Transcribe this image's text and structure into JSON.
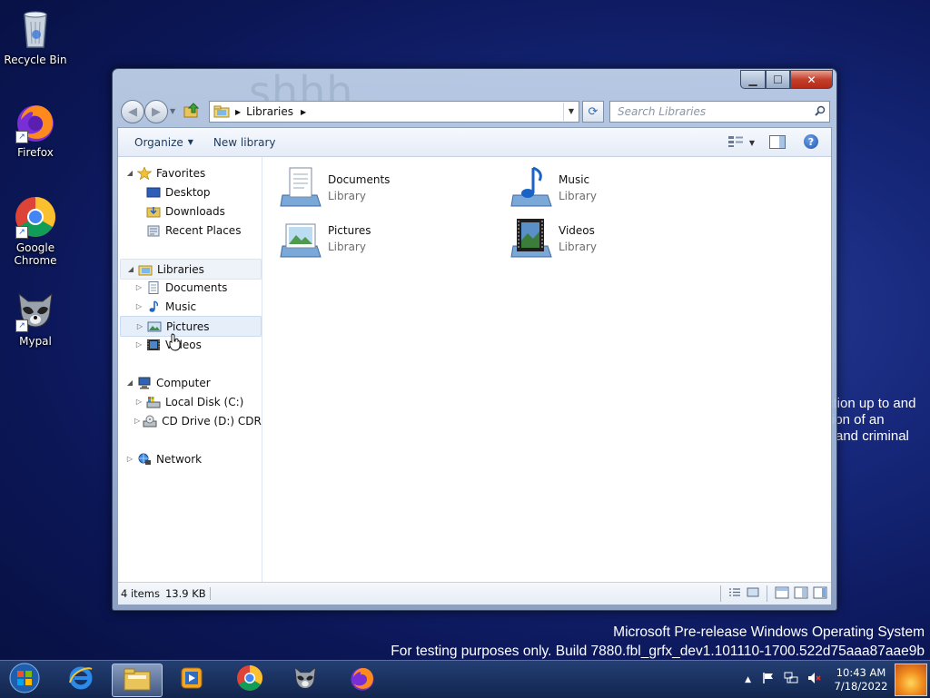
{
  "desktop": {
    "icons": [
      {
        "label": "Recycle Bin"
      },
      {
        "label": "Firefox"
      },
      {
        "label": "Google Chrome"
      },
      {
        "label": "Mypal"
      }
    ],
    "background_text": [
      "ction up to and",
      "ion of an",
      "and criminal"
    ],
    "watermark": {
      "line1": "Microsoft Pre-release Windows Operating System",
      "line2": "For testing purposes only. Build 7880.fbl_grfx_dev1.101110-1700.522d75aaa87aae9b"
    }
  },
  "window": {
    "title_ghost": "shhh",
    "address": {
      "crumbs": [
        "Libraries"
      ]
    },
    "search": {
      "placeholder": "Search Libraries"
    },
    "toolbar": {
      "organize": "Organize",
      "new_library": "New library"
    },
    "nav": {
      "favorites": {
        "label": "Favorites",
        "items": [
          "Desktop",
          "Downloads",
          "Recent Places"
        ]
      },
      "libraries": {
        "label": "Libraries",
        "items": [
          "Documents",
          "Music",
          "Pictures",
          "Videos"
        ]
      },
      "computer": {
        "label": "Computer",
        "items": [
          "Local Disk (C:)",
          "CD Drive (D:) CDROM"
        ]
      },
      "network": {
        "label": "Network"
      }
    },
    "libraries": [
      {
        "name": "Documents",
        "type": "Library"
      },
      {
        "name": "Music",
        "type": "Library"
      },
      {
        "name": "Pictures",
        "type": "Library"
      },
      {
        "name": "Videos",
        "type": "Library"
      }
    ],
    "status": {
      "items": "4 items",
      "size": "13.9 KB"
    }
  },
  "taskbar": {
    "items": [
      "start",
      "internet-explorer",
      "windows-explorer",
      "media-player",
      "chrome",
      "mypal",
      "firefox"
    ],
    "clock": {
      "time": "10:43 AM",
      "date": "7/18/2022"
    }
  },
  "colors": {
    "selection": "#e5eef9",
    "link_text": "#1e395b",
    "close_red": "#c4402b"
  }
}
